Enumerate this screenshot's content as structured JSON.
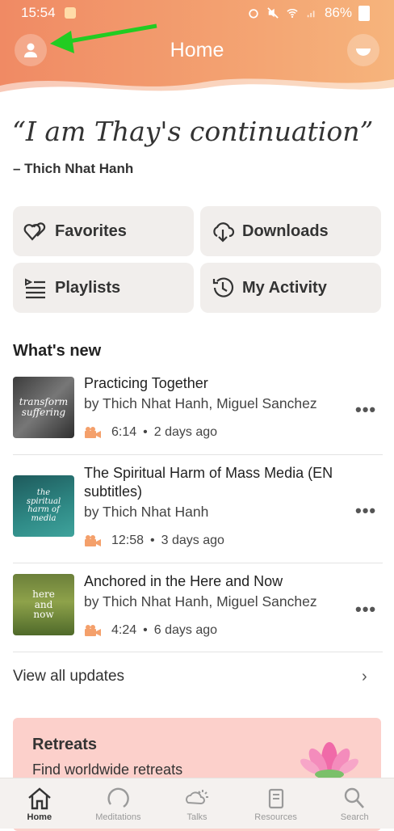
{
  "status": {
    "time": "15:54",
    "battery": "86%"
  },
  "header": {
    "title": "Home"
  },
  "quote": {
    "text": "“I am Thay's continuation”",
    "author": "– Thich Nhat Hanh"
  },
  "tiles": [
    {
      "label": "Favorites",
      "icon": "hearts-icon"
    },
    {
      "label": "Downloads",
      "icon": "cloud-download-icon"
    },
    {
      "label": "Playlists",
      "icon": "playlist-icon"
    },
    {
      "label": "My Activity",
      "icon": "history-icon"
    }
  ],
  "whats_new": {
    "title": "What's new",
    "items": [
      {
        "title": "Practicing Together",
        "author": "by Thich Nhat Hanh, Miguel Sanchez",
        "duration": "6:14",
        "age": "2 days ago",
        "thumb_text": "transform suffering"
      },
      {
        "title": "The Spiritual Harm of Mass Media (EN subtitles)",
        "author": "by Thich Nhat Hanh",
        "duration": "12:58",
        "age": "3 days ago",
        "thumb_text": "the spiritual harm of media"
      },
      {
        "title": "Anchored in the Here and Now",
        "author": "by Thich Nhat Hanh, Miguel Sanchez",
        "duration": "4:24",
        "age": "6 days ago",
        "thumb_text": "here and now"
      }
    ],
    "view_all": "View all updates"
  },
  "retreats": {
    "title": "Retreats",
    "subtitle": "Find worldwide retreats"
  },
  "tabs": [
    {
      "label": "Home",
      "active": true
    },
    {
      "label": "Meditations",
      "active": false
    },
    {
      "label": "Talks",
      "active": false
    },
    {
      "label": "Resources",
      "active": false
    },
    {
      "label": "Search",
      "active": false
    }
  ],
  "colors": {
    "accent": "#f4a06b",
    "header_start": "#f08a64",
    "header_end": "#f6b47c",
    "retreat_bg": "#fcd0cb",
    "tile_bg": "#f1eeec"
  }
}
